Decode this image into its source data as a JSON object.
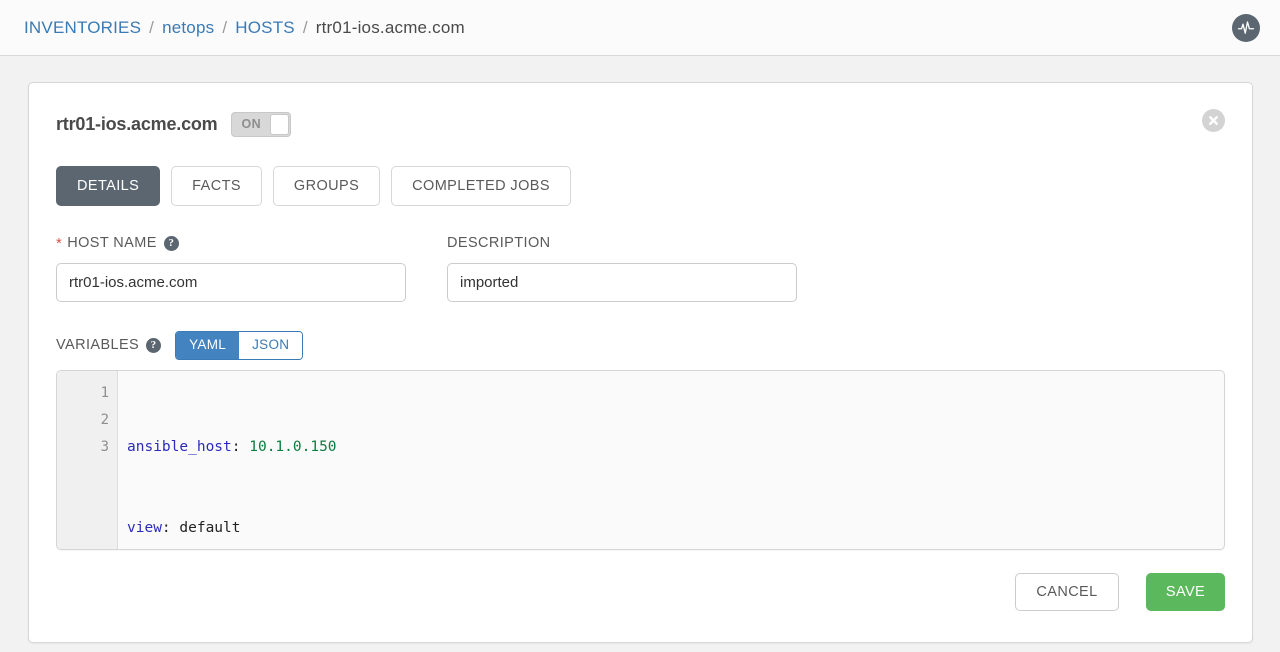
{
  "breadcrumb": {
    "items": [
      {
        "label": "INVENTORIES",
        "type": "link"
      },
      {
        "label": "netops",
        "type": "link"
      },
      {
        "label": "HOSTS",
        "type": "link"
      },
      {
        "label": "rtr01-ios.acme.com",
        "type": "current"
      }
    ],
    "separator": "/"
  },
  "header": {
    "logo_icon": "activity-pulse-icon"
  },
  "card": {
    "title": "rtr01-ios.acme.com",
    "enabled_toggle": {
      "label": "ON",
      "state": "on"
    },
    "close_icon": "close-circle-icon",
    "tabs": [
      {
        "label": "DETAILS",
        "active": true
      },
      {
        "label": "FACTS",
        "active": false
      },
      {
        "label": "GROUPS",
        "active": false
      },
      {
        "label": "COMPLETED JOBS",
        "active": false
      }
    ],
    "fields": {
      "host_name": {
        "label": "HOST NAME",
        "required_marker": "*",
        "help_icon": "question-mark-icon",
        "value": "rtr01-ios.acme.com",
        "placeholder": ""
      },
      "description": {
        "label": "DESCRIPTION",
        "value": "imported",
        "placeholder": ""
      }
    },
    "variables": {
      "label": "VARIABLES",
      "help_icon": "question-mark-icon",
      "formats": [
        {
          "label": "YAML",
          "active": true
        },
        {
          "label": "JSON",
          "active": false
        }
      ],
      "line_numbers": [
        "1",
        "2",
        "3"
      ],
      "lines": [
        {
          "key": "ansible_host",
          "punct": ": ",
          "value": "10.1.0.150",
          "value_type": "string"
        },
        {
          "key": "view",
          "punct": ": ",
          "value": "default",
          "value_type": "plain"
        },
        {
          "key": "",
          "punct": "",
          "value": "",
          "value_type": "plain"
        }
      ]
    },
    "footer": {
      "cancel_label": "CANCEL",
      "save_label": "SAVE"
    }
  },
  "colors": {
    "link": "#3a7ab5",
    "accent_blue": "#4383bf",
    "dark_slate": "#5b6670",
    "save_green": "#5cb85c",
    "required_red": "#d9534f",
    "page_bg": "#f2f2f2"
  }
}
